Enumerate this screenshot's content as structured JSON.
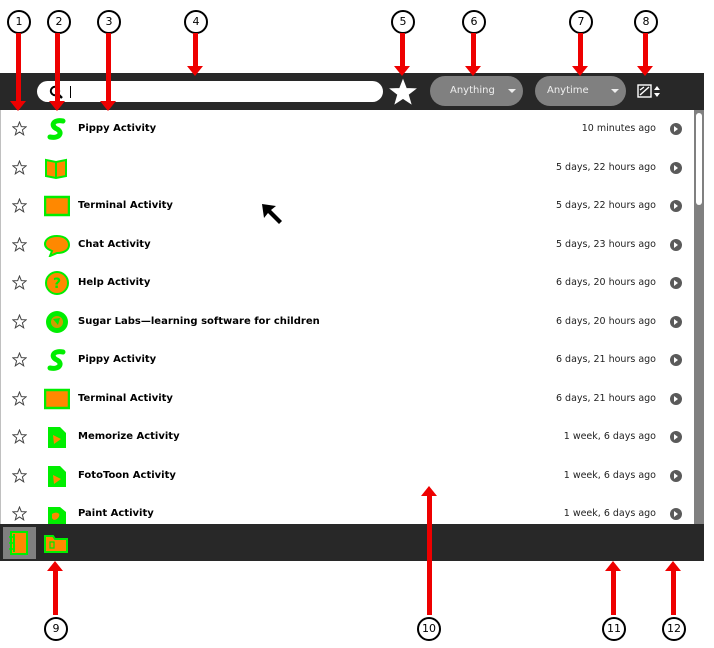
{
  "callouts": [
    "1",
    "2",
    "3",
    "4",
    "5",
    "6",
    "7",
    "8",
    "9",
    "10",
    "11",
    "12"
  ],
  "toolbar": {
    "search_value": "",
    "search_icon": "magnifier-icon",
    "favorite_filter_icon": "star-icon",
    "type_filter": "Anything",
    "time_filter": "Anytime",
    "sort_icon": "sort-view-icon"
  },
  "entries": [
    {
      "title": "Pippy Activity",
      "date": "10 minutes ago",
      "icon": "pippy-icon"
    },
    {
      "title": "",
      "date": "5 days, 22 hours ago",
      "icon": "book-icon"
    },
    {
      "title": "Terminal Activity",
      "date": "5 days, 22 hours ago",
      "icon": "terminal-icon"
    },
    {
      "title": "Chat Activity",
      "date": "5 days, 23 hours ago",
      "icon": "chat-icon"
    },
    {
      "title": "Help Activity",
      "date": "6 days, 20 hours ago",
      "icon": "help-icon"
    },
    {
      "title": "Sugar Labs—learning software for children",
      "date": "6 days, 20 hours ago",
      "icon": "browse-icon"
    },
    {
      "title": "Pippy Activity",
      "date": "6 days, 21 hours ago",
      "icon": "pippy-icon"
    },
    {
      "title": "Terminal Activity",
      "date": "6 days, 21 hours ago",
      "icon": "terminal-icon"
    },
    {
      "title": "Memorize Activity",
      "date": "1 week, 6 days ago",
      "icon": "memorize-icon"
    },
    {
      "title": "FotoToon Activity",
      "date": "1 week, 6 days ago",
      "icon": "fototoon-icon"
    },
    {
      "title": "Paint Activity",
      "date": "1 week, 6 days ago",
      "icon": "paint-icon"
    }
  ],
  "colors": {
    "toolbar": "#282828",
    "icon_fill": "#ff8800",
    "icon_stroke": "#00ee00",
    "annotation": "#ee0000"
  },
  "bottom_tray": [
    {
      "icon": "journal-icon",
      "active": true
    },
    {
      "icon": "documents-folder-icon",
      "active": false
    }
  ]
}
